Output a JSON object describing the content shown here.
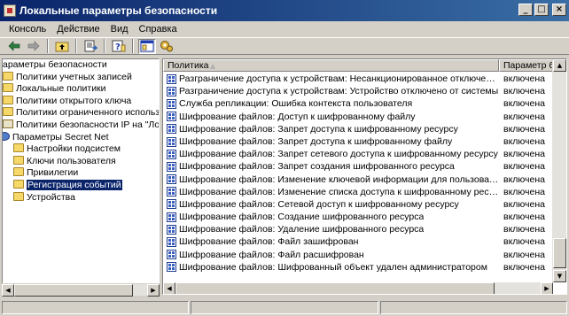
{
  "window": {
    "title": "Локальные параметры безопасности",
    "buttons": {
      "minimize": "_",
      "maximize": "□",
      "close": "×"
    }
  },
  "menu": [
    "Консоль",
    "Действие",
    "Вид",
    "Справка"
  ],
  "toolbar": [
    "back-icon",
    "forward-icon",
    "up-folder-icon",
    "export-list-icon",
    "help-icon",
    "show-tree-icon",
    "properties-icon"
  ],
  "tree": {
    "items": [
      {
        "label": "араметры безопасности",
        "icon": "folder",
        "indent": 0
      },
      {
        "label": "Политики учетных записей",
        "icon": "folder",
        "indent": 1
      },
      {
        "label": "Локальные политики",
        "icon": "folder",
        "indent": 1
      },
      {
        "label": "Политики открытого ключа",
        "icon": "folder",
        "indent": 1
      },
      {
        "label": "Политики ограниченного использования",
        "icon": "folder",
        "indent": 1
      },
      {
        "label": "Политики безопасности IP на \"Локальн",
        "icon": "doc",
        "indent": 1
      },
      {
        "label": "Параметры Secret Net",
        "icon": "net",
        "indent": 0
      },
      {
        "label": "Настройки подсистем",
        "icon": "folder",
        "indent": 2
      },
      {
        "label": "Ключи пользователя",
        "icon": "folder",
        "indent": 2
      },
      {
        "label": "Привилегии",
        "icon": "folder",
        "indent": 2
      },
      {
        "label": "Регистрация событий",
        "icon": "folder",
        "indent": 2,
        "selected": true
      },
      {
        "label": "Устройства",
        "icon": "folder",
        "indent": 2
      }
    ]
  },
  "list": {
    "columns": {
      "policy": "Политика",
      "sort": "▲",
      "setting": "Параметр безо"
    },
    "rows": [
      {
        "policy": "Разграничение доступа к устройствам: Несанкционированное отключение устро...",
        "value": "включена"
      },
      {
        "policy": "Разграничение доступа к устройствам: Устройство отключено от системы",
        "value": "включена"
      },
      {
        "policy": "Служба репликации: Ошибка контекста пользователя",
        "value": "включена"
      },
      {
        "policy": "Шифрование файлов: Доступ к шифрованному файлу",
        "value": "включена"
      },
      {
        "policy": "Шифрование файлов: Запрет доступа к шифрованному ресурсу",
        "value": "включена"
      },
      {
        "policy": "Шифрование файлов: Запрет доступа к шифрованному файлу",
        "value": "включена"
      },
      {
        "policy": "Шифрование файлов: Запрет сетевого доступа к шифрованному ресурсу",
        "value": "включена"
      },
      {
        "policy": "Шифрование файлов: Запрет создания шифрованного ресурса",
        "value": "включена"
      },
      {
        "policy": "Шифрование файлов: Изменение ключевой информации для пользователя",
        "value": "включена"
      },
      {
        "policy": "Шифрование файлов: Изменение списка доступа к шифрованному ресурсу",
        "value": "включена"
      },
      {
        "policy": "Шифрование файлов: Сетевой доступ к шифрованному ресурсу",
        "value": "включена"
      },
      {
        "policy": "Шифрование файлов: Создание шифрованного ресурса",
        "value": "включена"
      },
      {
        "policy": "Шифрование файлов: Удаление шифрованного ресурса",
        "value": "включена"
      },
      {
        "policy": "Шифрование файлов: Файл зашифрован",
        "value": "включена"
      },
      {
        "policy": "Шифрование файлов: Файл расшифрован",
        "value": "включена"
      },
      {
        "policy": "Шифрование файлов: Шифрованный объект удален администратором",
        "value": "включена"
      }
    ]
  }
}
